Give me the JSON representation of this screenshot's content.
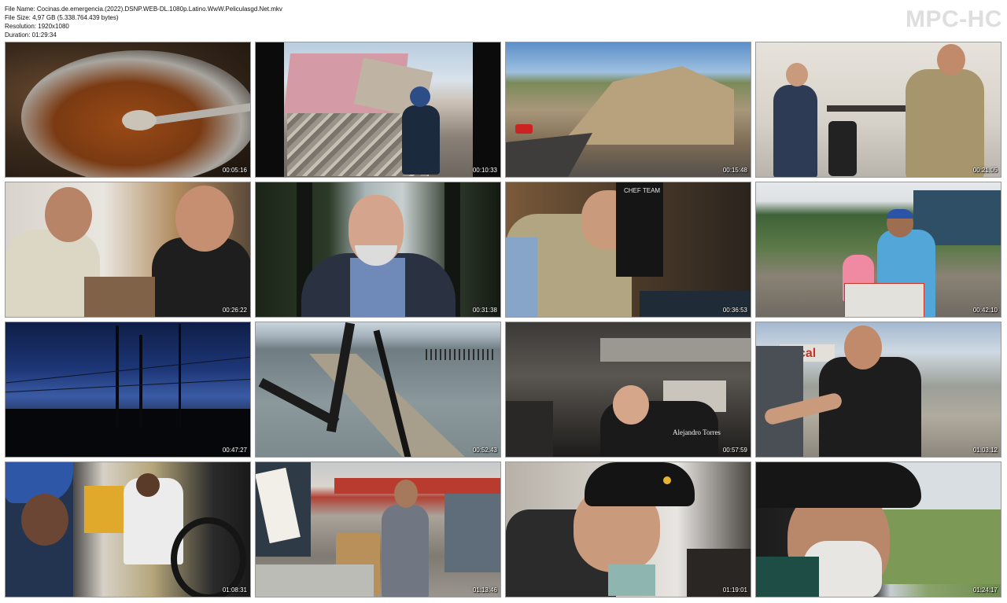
{
  "header": {
    "file_name": "File Name: Cocinas.de.emergencia.(2022).DSNP.WEB-DL.1080p.Latino.WwW.Peliculasgd.Net.mkv",
    "file_size": "File Size: 4,97 GB (5.338.764.439 bytes)",
    "resolution": "Resolution: 1920x1080",
    "duration": "Duration: 01:29:34"
  },
  "brand": "MPC-HC",
  "thumbnails": [
    {
      "timestamp": "00:05:16"
    },
    {
      "timestamp": "00:10:33"
    },
    {
      "timestamp": "00:15:48"
    },
    {
      "timestamp": "00:21:05"
    },
    {
      "timestamp": "00:26:22"
    },
    {
      "timestamp": "00:31:38"
    },
    {
      "timestamp": "00:36:53"
    },
    {
      "timestamp": "00:42:10"
    },
    {
      "timestamp": "00:47:27"
    },
    {
      "timestamp": "00:52:43"
    },
    {
      "timestamp": "00:57:59"
    },
    {
      "timestamp": "01:03:12"
    },
    {
      "timestamp": "01:08:31"
    },
    {
      "timestamp": "01:13:46"
    },
    {
      "timestamp": "01:19:01"
    },
    {
      "timestamp": "01:24:17"
    }
  ],
  "overlays": {
    "thumb_6_badge": "CHEF TEAM",
    "thumb_10_caption_name": "Alejandro Torres",
    "thumb_11_sign": "opical"
  }
}
